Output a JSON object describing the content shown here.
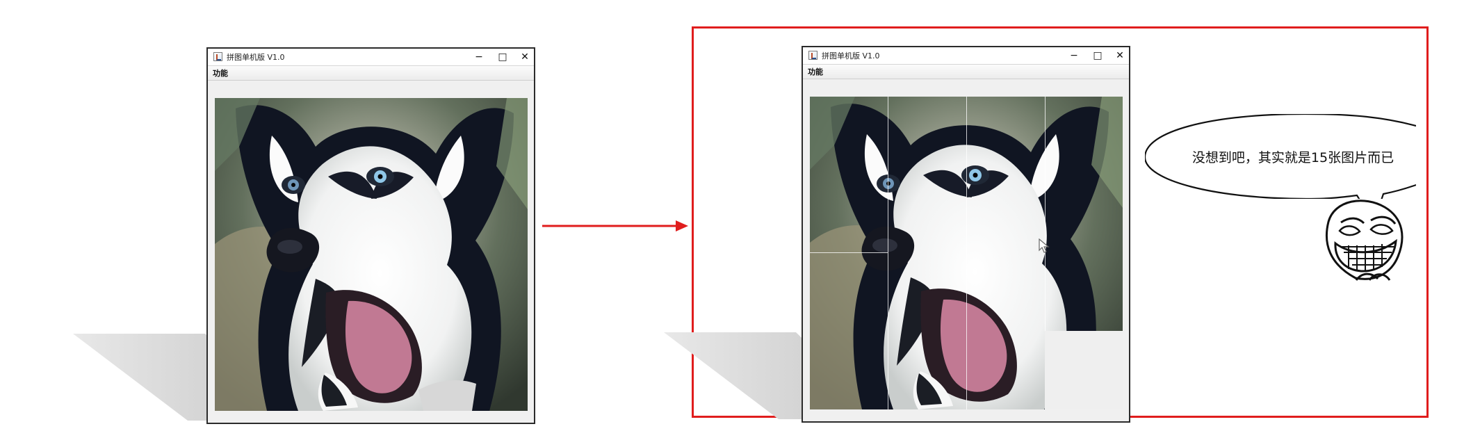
{
  "original_window": {
    "title": "拼图单机版 V1.0",
    "menu": {
      "label": "功能"
    },
    "controls": {
      "minimize": "−",
      "maximize": "□",
      "close": "✕"
    }
  },
  "puzzle_window": {
    "title": "拼图单机版 V1.0",
    "menu": {
      "label": "功能"
    },
    "controls": {
      "minimize": "−",
      "maximize": "□",
      "close": "✕"
    }
  },
  "annotation": {
    "speech_text": "没想到吧，其实就是15张图片而已",
    "frame_color": "#e01d1d",
    "arrow_color": "#e01d1d"
  },
  "icons": {
    "app": "puzzle-app-icon",
    "cursor": "mouse-cursor-icon",
    "meme": "trollface-meme-icon",
    "arrow": "right-arrow-icon"
  }
}
